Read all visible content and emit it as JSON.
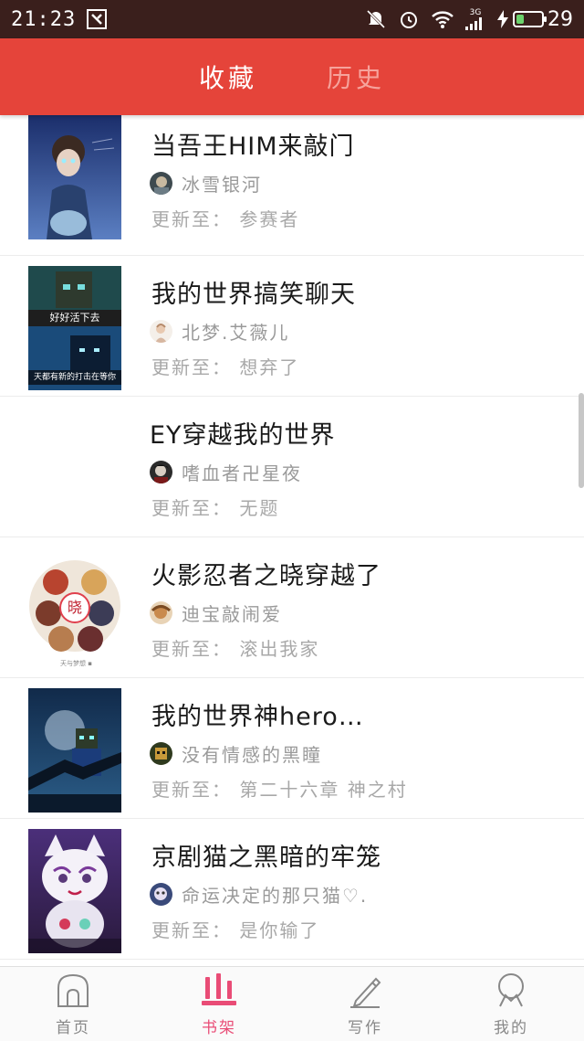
{
  "status_bar": {
    "time": "21:23",
    "network": "3G",
    "battery": "29",
    "battery_level": 0.29
  },
  "header": {
    "tabs": [
      {
        "label": "收藏",
        "active": true
      },
      {
        "label": "历史",
        "active": false
      }
    ]
  },
  "books": [
    {
      "title": "当吾王HIM来敲门",
      "author": "冰雪银河",
      "update": "更新至： 参赛者"
    },
    {
      "title": "我的世界搞笑聊天",
      "author": "北梦.艾薇儿",
      "update": "更新至： 想弃了",
      "cover_text_top": "好好活下去",
      "cover_text_bottom": "天都有新的打击在等你"
    },
    {
      "title": "EY穿越我的世界",
      "author": "嗜血者卍星夜",
      "update": "更新至： 无题"
    },
    {
      "title": "火影忍者之晓穿越了",
      "author": "迪宝敲闹爱",
      "update": "更新至： 滚出我家",
      "cover_text_center": "晓"
    },
    {
      "title": "我的世界神hero…",
      "author": "没有情感的黑瞳",
      "update": "更新至： 第二十六章 神之村"
    },
    {
      "title": "京剧猫之黑暗的牢笼",
      "author": "命运决定的那只猫♡.",
      "update": "更新至： 是你输了"
    }
  ],
  "bottom_nav": [
    {
      "label": "首页",
      "icon": "home-icon",
      "active": false
    },
    {
      "label": "书架",
      "icon": "bookshelf-icon",
      "active": true
    },
    {
      "label": "写作",
      "icon": "pencil-icon",
      "active": false
    },
    {
      "label": "我的",
      "icon": "profile-icon",
      "active": false
    }
  ],
  "colors": {
    "header": "#e5443a",
    "active_tab_text": "#ffffff",
    "inactive_tab_text": "#f6a39c",
    "nav_active": "#e94c76",
    "nav_inactive": "#888888"
  }
}
